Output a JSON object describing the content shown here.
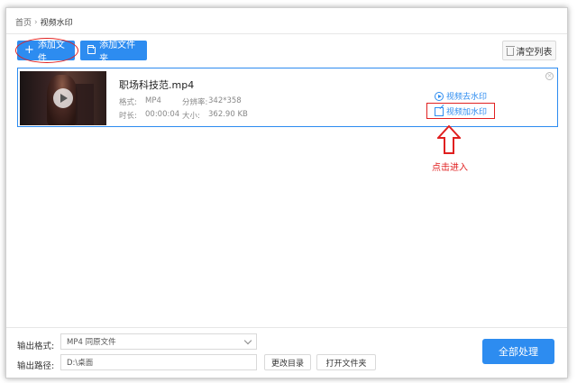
{
  "breadcrumb": {
    "home": "首页",
    "separator": "›",
    "current": "视频水印"
  },
  "toolbar": {
    "add_file_label": "添加文件",
    "add_folder_label": "添加文件夹",
    "clear_list_label": "清空列表"
  },
  "files": [
    {
      "name": "职场科技范.mp4",
      "format_label": "格式:",
      "format_value": "MP4",
      "resolution_label": "分辨率:",
      "resolution_value": "342*358",
      "duration_label": "时长:",
      "duration_value": "00:00:04",
      "size_label": "大小:",
      "size_value": "362.90 KB",
      "action_remove": "视频去水印",
      "action_add": "视频加水印"
    }
  ],
  "annotation": {
    "click_hint": "点击进入"
  },
  "output": {
    "format_label": "输出格式:",
    "format_value": "MP4  同原文件",
    "path_label": "输出路径:",
    "path_value": "D:\\桌面",
    "change_dir_label": "更改目录",
    "open_folder_label": "打开文件夹",
    "process_all_label": "全部处理"
  },
  "colors": {
    "accent": "#2d8cf0",
    "annotation_red": "#e02020"
  },
  "icons": [
    "plus-icon",
    "folder-icon",
    "trash-icon",
    "play-icon",
    "circle-play-icon",
    "edit-icon",
    "close-icon",
    "chevron-down-icon",
    "arrow-up-icon"
  ]
}
